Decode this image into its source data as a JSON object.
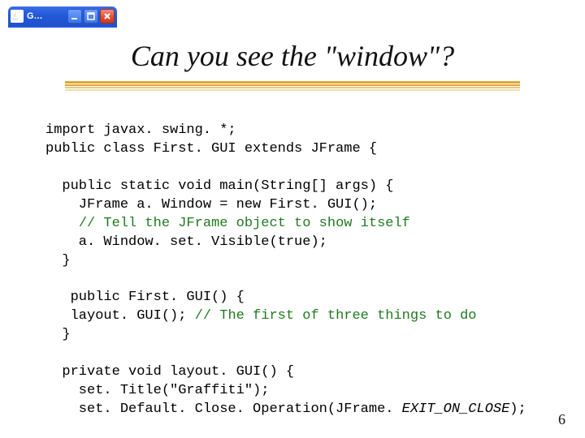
{
  "window": {
    "title": "G…"
  },
  "slide": {
    "title": "Can you see the \"window\"?",
    "number": "6"
  },
  "code": {
    "l1": "import javax. swing. *;",
    "l2": "public class First. GUI extends JFrame {",
    "l3": "  public static void main(String[] args) {",
    "l4": "    JFrame a. Window = new First. GUI();",
    "l5a": "    ",
    "l5c": "// Tell the JFrame object to show itself",
    "l6": "    a. Window. set. Visible(true);",
    "l7": "  }",
    "l8": "   public First. GUI() {",
    "l9a": "   layout. GUI(); ",
    "l9c": "// The first of three things to do",
    "l10": "  }",
    "l11": "  private void layout. GUI() {",
    "l12": "    set. Title(\"Graffiti\");",
    "l13a": "    set. Default. Close. Operation(JFrame. ",
    "l13i": "EXIT_ON_CLOSE",
    "l13b": ");"
  }
}
